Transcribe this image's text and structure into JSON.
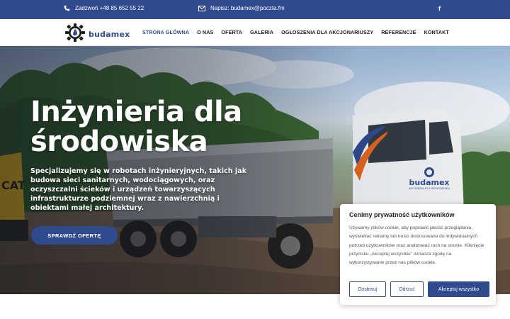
{
  "topbar": {
    "phone": "Zadzwoń +48 85 652 55 22",
    "email": "Napisz: budamex@poczta.fm",
    "social": "f"
  },
  "logo": {
    "text": "budamex"
  },
  "nav": {
    "items": [
      {
        "label": "STRONA GŁÓWNA",
        "active": true
      },
      {
        "label": "O NAS"
      },
      {
        "label": "OFERTA"
      },
      {
        "label": "GALERIA"
      },
      {
        "label": "OGŁOSZENIA DLA AKCJONARIUSZY"
      },
      {
        "label": "REFERENCJE"
      },
      {
        "label": "KONTAKT"
      }
    ]
  },
  "hero": {
    "title": "Inżynieria dla środowiska",
    "lead": "Specjalizujemy się w robotach inżynieryjnych, takich jak budowa sieci sanitarnych, wodociągowych, oraz oczyszczalni ścieków i urządzeń towarzyszących infrastrukturze podziemnej wraz z nawierzchnią i obiektami małej architektury.",
    "cta": "SPRAWDŹ OFERTĘ",
    "truck_brand": "budamex",
    "truck_subtext": "INŻYNIERIA DLA ŚRODOWISKA",
    "excavator_brand": "CAT"
  },
  "cookie": {
    "title": "Cenimy prywatność użytkowników",
    "text": "Używamy plików cookie, aby poprawić jakość przeglądania, wyświetlać reklamy lub treści dostosowane do indywidualnych potrzeb użytkowników oraz analizować ruch na stronie. Kliknięcie przycisku „Akceptuj wszystkie” oznacza zgodę na wykorzystywanie przez nas plików cookie.",
    "customize": "Dostosuj",
    "reject": "Odrzuć",
    "accept": "Akceptuj wszystko"
  },
  "colors": {
    "brand": "#2f4a8e",
    "white": "#ffffff"
  }
}
